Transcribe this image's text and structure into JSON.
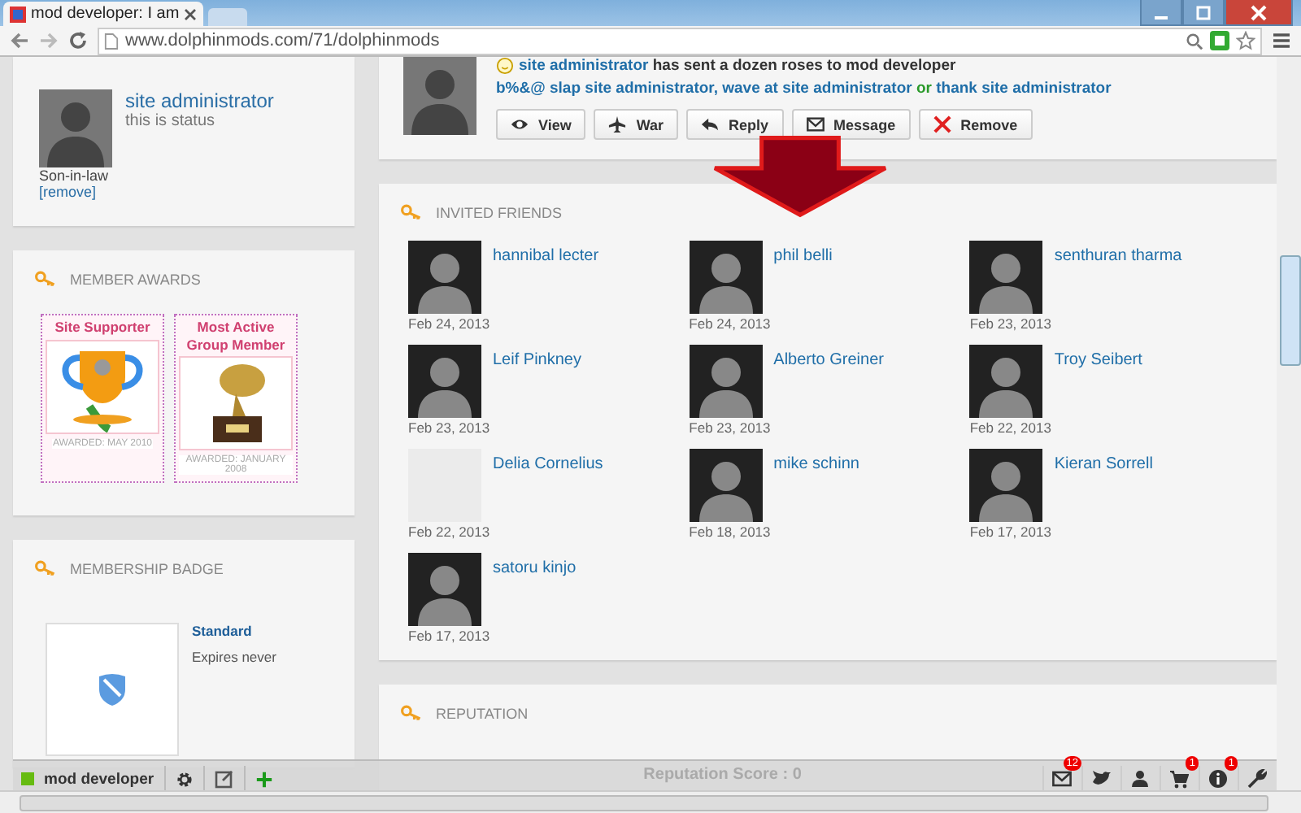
{
  "browser": {
    "tab_title": "mod developer: I am",
    "url": "www.dolphinmods.com/71/dolphinmods"
  },
  "profile_card": {
    "name": "site administrator",
    "status": "this is status",
    "relation": "Son-in-law",
    "remove_link": "[remove]"
  },
  "activity": {
    "lines": [
      [
        {
          "text": "site administrator",
          "kind": "link"
        },
        {
          "text": " has sent a dozen roses to mod developer",
          "kind": "plain"
        }
      ],
      [
        {
          "text": "b%&@ slap site administrator, wave at site administrator",
          "kind": "link"
        },
        {
          "text": " or ",
          "kind": "green"
        },
        {
          "text": "thank site administrator",
          "kind": "link"
        }
      ]
    ],
    "buttons": [
      {
        "label": "View",
        "kind": "eye"
      },
      {
        "label": "War",
        "kind": "plane"
      },
      {
        "label": "Reply",
        "kind": "reply"
      },
      {
        "label": "Message",
        "kind": "mail"
      },
      {
        "label": "Remove",
        "kind": "remove"
      }
    ]
  },
  "member_awards": {
    "title": "MEMBER AWARDS",
    "awards": [
      {
        "title": "Site Supporter",
        "awarded": "AWARDED: MAY 2010",
        "kind": "cup"
      },
      {
        "title": "Most Active Group Member",
        "awarded": "AWARDED: JANUARY 2008",
        "kind": "trophy"
      }
    ]
  },
  "membership_badge": {
    "title": "MEMBERSHIP BADGE",
    "level": "Standard",
    "expires": "Expires never"
  },
  "invited_friends": {
    "title": "INVITED FRIENDS",
    "friends": [
      {
        "name": "hannibal lecter",
        "date": "Feb 24, 2013",
        "has_avatar": true
      },
      {
        "name": "phil belli",
        "date": "Feb 24, 2013",
        "has_avatar": true
      },
      {
        "name": "senthuran tharma",
        "date": "Feb 23, 2013",
        "has_avatar": true
      },
      {
        "name": "Leif Pinkney",
        "date": "Feb 23, 2013",
        "has_avatar": true
      },
      {
        "name": "Alberto Greiner",
        "date": "Feb 23, 2013",
        "has_avatar": true
      },
      {
        "name": "Troy Seibert",
        "date": "Feb 22, 2013",
        "has_avatar": true
      },
      {
        "name": "Delia Cornelius",
        "date": "Feb 22, 2013",
        "has_avatar": false
      },
      {
        "name": "mike schinn",
        "date": "Feb 18, 2013",
        "has_avatar": true
      },
      {
        "name": "Kieran Sorrell",
        "date": "Feb 17, 2013",
        "has_avatar": true
      },
      {
        "name": "satoru kinjo",
        "date": "Feb 17, 2013",
        "has_avatar": true
      }
    ]
  },
  "reputation": {
    "title": "REPUTATION",
    "score": "Reputation Score : 0"
  },
  "toolbar": {
    "user": "mod developer",
    "right_icons": [
      {
        "kind": "mail",
        "badge": "12"
      },
      {
        "kind": "bird"
      },
      {
        "kind": "person"
      },
      {
        "kind": "cart",
        "badge": "1"
      },
      {
        "kind": "info",
        "badge": "1"
      },
      {
        "kind": "wrench"
      }
    ]
  }
}
